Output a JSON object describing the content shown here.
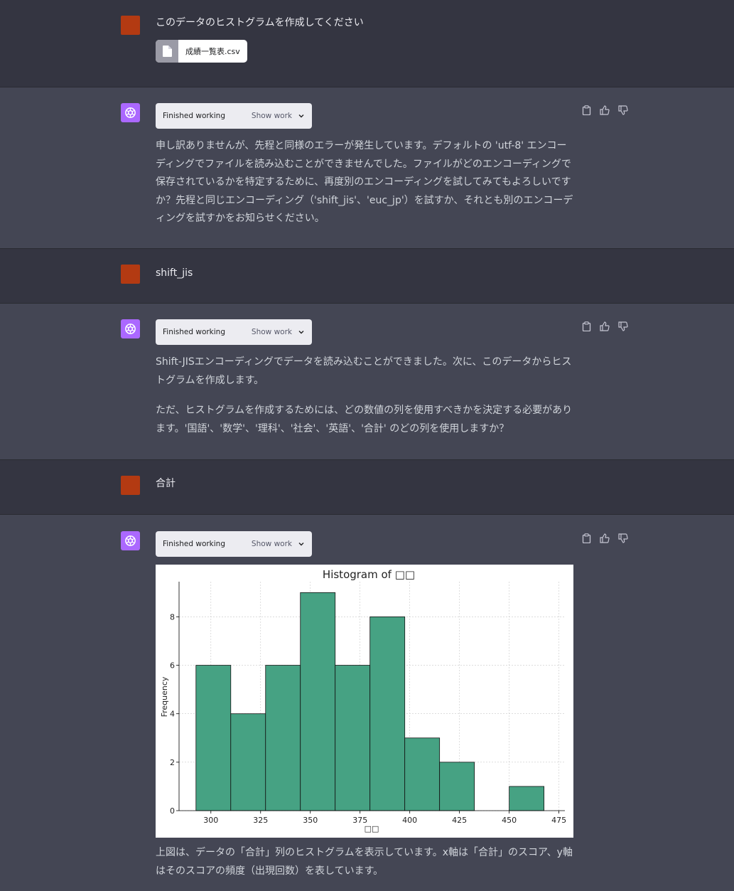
{
  "turns": {
    "u1": {
      "text": "このデータのヒストグラムを作成してください",
      "file_name": "成績一覧表.csv"
    },
    "a1": {
      "status": "Finished working",
      "show_work": "Show work",
      "text": "申し訳ありませんが、先程と同様のエラーが発生しています。デフォルトの 'utf-8' エンコーディングでファイルを読み込むことができませんでした。ファイルがどのエンコーディングで保存されているかを特定するために、再度別のエンコーディングを試してみてもよろしいですか？先程と同じエンコーディング（'shift_jis'、'euc_jp'）を試すか、それとも別のエンコーディングを試すかをお知らせください。"
    },
    "u2": {
      "text": "shift_jis"
    },
    "a2": {
      "status": "Finished working",
      "show_work": "Show work",
      "para1": "Shift-JISエンコーディングでデータを読み込むことができました。次に、このデータからヒストグラムを作成します。",
      "para2": "ただ、ヒストグラムを作成するためには、どの数値の列を使用すべきかを決定する必要があります。'国語'、'数学'、'理科'、'社会'、'英語'、'合計' のどの列を使用しますか？"
    },
    "u3": {
      "text": "合計"
    },
    "a3": {
      "status": "Finished working",
      "show_work": "Show work",
      "text": "上図は、データの「合計」列のヒストグラムを表示しています。x軸は「合計」のスコア、y軸はそのスコアの頻度（出現回数）を表しています。"
    }
  },
  "colors": {
    "bar": "#46a283",
    "bar_edge": "#111111",
    "grid": "#c8c8c8",
    "user_avatar": "#b33a12",
    "bot_avatar": "#ab68ff"
  },
  "icons": [
    "file-icon",
    "openai-logo-icon",
    "chevron-down-icon",
    "copy-icon",
    "thumbs-up-icon",
    "thumbs-down-icon"
  ],
  "chart_data": {
    "type": "bar",
    "title": "Histogram of □□",
    "xlabel": "□□",
    "ylabel": "Frequency",
    "bins": [
      {
        "x0": 292.5,
        "x1": 310,
        "count": 6
      },
      {
        "x0": 310,
        "x1": 327.5,
        "count": 4
      },
      {
        "x0": 327.5,
        "x1": 345,
        "count": 6
      },
      {
        "x0": 345,
        "x1": 362.5,
        "count": 9
      },
      {
        "x0": 362.5,
        "x1": 380,
        "count": 6
      },
      {
        "x0": 380,
        "x1": 397.5,
        "count": 8
      },
      {
        "x0": 397.5,
        "x1": 415,
        "count": 3
      },
      {
        "x0": 415,
        "x1": 432.5,
        "count": 2
      },
      {
        "x0": 432.5,
        "x1": 450,
        "count": 0
      },
      {
        "x0": 450,
        "x1": 467.5,
        "count": 1
      }
    ],
    "xticks": [
      300,
      325,
      350,
      375,
      400,
      425,
      450,
      475
    ],
    "yticks": [
      0,
      2,
      4,
      6,
      8
    ],
    "xlim": [
      284,
      478
    ],
    "ylim": [
      0,
      9.45
    ],
    "grid": true
  }
}
